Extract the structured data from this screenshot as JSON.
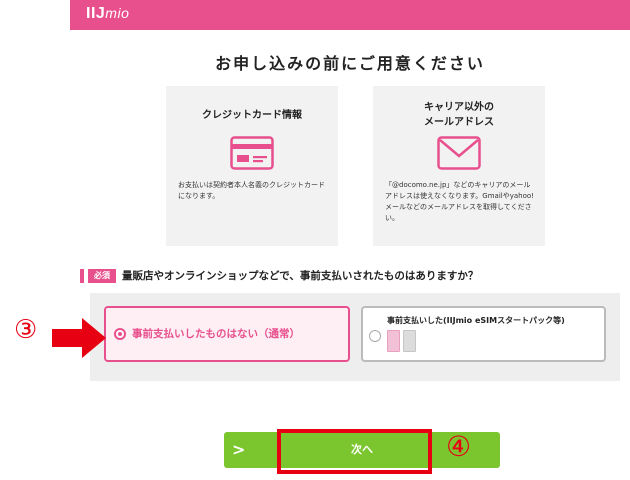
{
  "header": {
    "logo_main": "IIJ",
    "logo_sub": "mio",
    "color": "#e8508d"
  },
  "page_title": "お申し込みの前にご用意ください",
  "cards": [
    {
      "title": "クレジットカード情報",
      "icon": "credit-card-icon",
      "text": "お支払いは契約者本人名義のクレジットカードになります。"
    },
    {
      "title_line1": "キャリア以外の",
      "title_line2": "メールアドレス",
      "icon": "envelope-icon",
      "text": "「@docomo.ne.jp」などのキャリアのメールアドレスは使えなくなります。Gmailやyahoo!メールなどのメールアドレスを取得してください。"
    }
  ],
  "question": {
    "badge": "必須",
    "text": "量販店やオンラインショップなどで、事前支払いされたものはありますか？"
  },
  "options": [
    {
      "label": "事前支払いしたものはない（通常）",
      "selected": true
    },
    {
      "label": "事前支払いした(IIJmio eSIMスタートパック等)",
      "selected": false
    }
  ],
  "annotations": {
    "step3": "③",
    "step4": "④",
    "color": "#e60012"
  },
  "next_button": {
    "chevron": ">",
    "label": "次へ",
    "color": "#7bc52e"
  }
}
